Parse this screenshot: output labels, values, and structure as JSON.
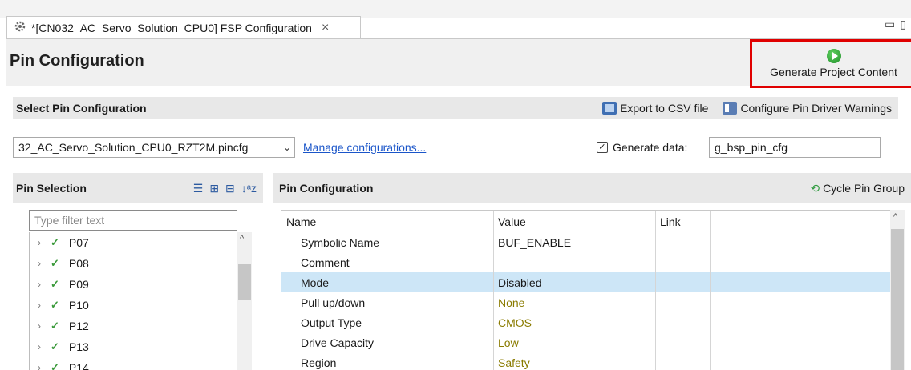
{
  "tab": {
    "title": "*[CN032_AC_Servo_Solution_CPU0] FSP Configuration",
    "close": "×",
    "icon": "gear-icon"
  },
  "window_controls": {
    "minimize": "▭",
    "maximize": "▯"
  },
  "page": {
    "title": "Pin Configuration"
  },
  "generate_button": {
    "label": "Generate Project Content",
    "icon": "play-icon",
    "color": "#2f9b3f",
    "highlight": "#e00000"
  },
  "select_section": {
    "title": "Select Pin Configuration",
    "export_label": "Export to CSV file",
    "warnings_label": "Configure Pin Driver Warnings",
    "config_value": "32_AC_Servo_Solution_CPU0_RZT2M.pincfg",
    "manage_label": "Manage configurations...",
    "generate_data_label": "Generate data:",
    "generate_data_checked": true,
    "generate_data_value": "g_bsp_pin_cfg"
  },
  "pin_selection": {
    "title": "Pin Selection",
    "filter_placeholder": "Type filter text",
    "items": [
      "P07",
      "P08",
      "P09",
      "P10",
      "P12",
      "P13",
      "P14"
    ]
  },
  "pin_configuration": {
    "title": "Pin Configuration",
    "cycle_label": "Cycle Pin Group",
    "columns": [
      "Name",
      "Value",
      "Link"
    ],
    "rows": [
      {
        "name": "Symbolic Name",
        "value": "BUF_ENABLE",
        "default": false
      },
      {
        "name": "Comment",
        "value": "",
        "default": false
      },
      {
        "name": "Mode",
        "value": "Disabled",
        "default": false,
        "selected": true
      },
      {
        "name": "Pull up/down",
        "value": "None",
        "default": true
      },
      {
        "name": "Output Type",
        "value": "CMOS",
        "default": true
      },
      {
        "name": "Drive Capacity",
        "value": "Low",
        "default": true
      },
      {
        "name": "Region",
        "value": "Safety",
        "default": true
      }
    ]
  }
}
